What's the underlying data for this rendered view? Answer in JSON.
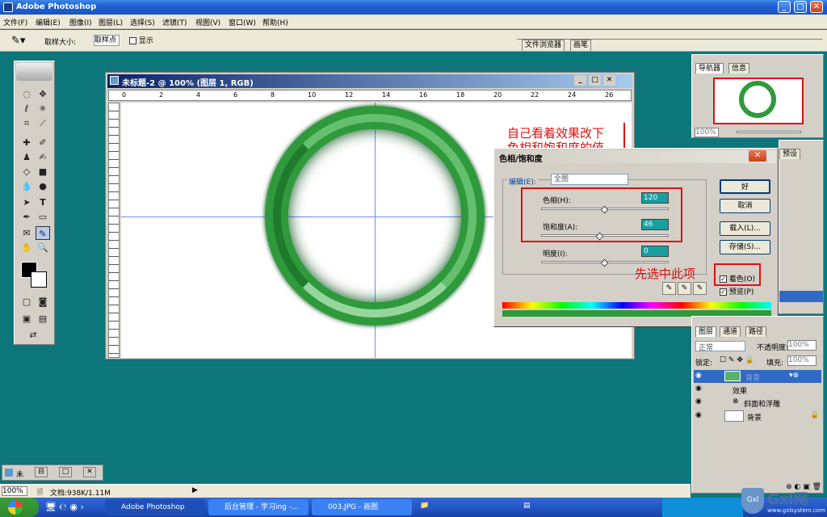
{
  "app": {
    "title": "Adobe Photoshop"
  },
  "menu": [
    "文件(F)",
    "编辑(E)",
    "图像(I)",
    "图层(L)",
    "选择(S)",
    "滤镜(T)",
    "视图(V)",
    "窗口(W)",
    "帮助(H)"
  ],
  "options": {
    "sample_size_label": "取样大小:",
    "sample_value": "取样点",
    "show_label": "显示",
    "tab_file_browser": "文件浏览器",
    "tab_brushes": "画笔"
  },
  "document": {
    "title": "未标题-2 @ 100% (图层 1, RGB)",
    "ruler_ticks": [
      "0",
      "2",
      "4",
      "6",
      "8",
      "10",
      "12",
      "14",
      "16",
      "18",
      "20",
      "22",
      "24",
      "26"
    ]
  },
  "dialog": {
    "title": "色相/饱和度",
    "edit_label": "编辑(E):",
    "edit_value": "全图",
    "hue_label": "色相(H):",
    "hue_value": "120",
    "sat_label": "饱和度(A):",
    "sat_value": "46",
    "light_label": "明度(I):",
    "light_value": "0",
    "hue_fraction": 0.5,
    "sat_fraction": 0.46,
    "light_fraction": 0.5,
    "ok": "好",
    "cancel": "取消",
    "load": "载入(L)...",
    "save": "存储(S)...",
    "colorize": "着色(O)",
    "preview": "预览(P)"
  },
  "annotations": {
    "top_line1": "自己看着效果改下",
    "top_line2": "色相和饱和度的值",
    "bottom": "先选中此项"
  },
  "navigator": {
    "tab1": "导航器",
    "tab2": "信息",
    "zoom": "100%"
  },
  "history_panel": {
    "tab_partial": "预设"
  },
  "layers": {
    "tab_layers": "图层",
    "tab_channels": "通道",
    "tab_paths": "路径",
    "blend_mode": "正常",
    "opacity_label": "不透明度:",
    "opacity_value": "100%",
    "lock_label": "锁定:",
    "fill_label": "填充:",
    "fill_value": "100%",
    "rows": [
      {
        "name": "背景"
      },
      {
        "name": "效果"
      },
      {
        "name": "斜面和浮雕"
      },
      {
        "name": "背景"
      }
    ]
  },
  "status": {
    "zoom": "100%",
    "doc_info": "文档:938K/1.11M"
  },
  "mini_window": {
    "title": "未"
  },
  "taskbar": {
    "items": [
      "Adobe Photoshop",
      "后台管理 - 学习ing -...",
      "003.JPG - 画图"
    ]
  },
  "watermark": {
    "text": "Gxl网",
    "url": "www.gxlsystem.com"
  },
  "colors": {
    "teal_bg": "#0d767a",
    "ring_green": "#2e9a3c",
    "red_mark": "#e01010",
    "field_teal": "#1b9ea0"
  }
}
